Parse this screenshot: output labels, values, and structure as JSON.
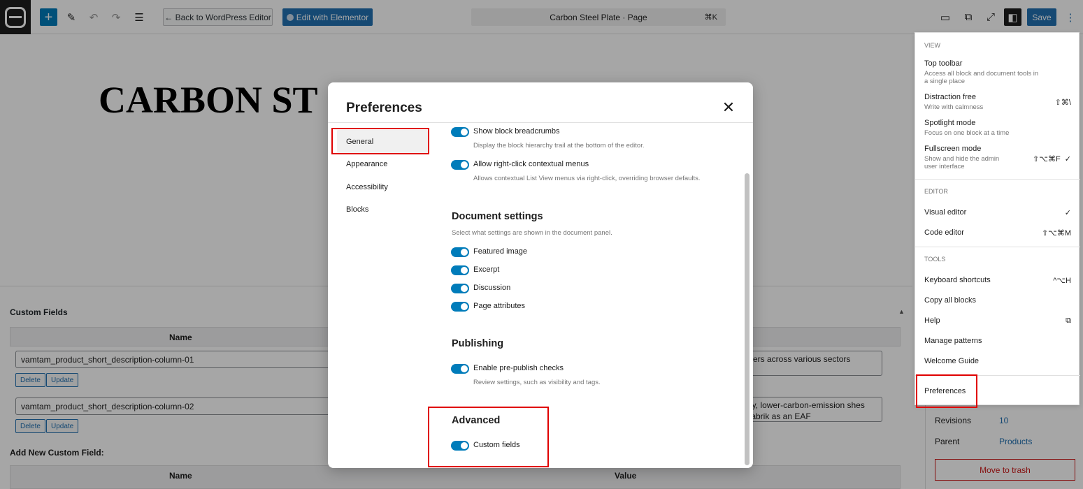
{
  "topbar": {
    "back_label": "← Back to WordPress Editor",
    "elementor_label": "Edit with Elementor",
    "doc_title": "Carbon Steel Plate · Page",
    "doc_shortcut": "⌘K",
    "save_label": "Save"
  },
  "canvas": {
    "title": "CARBON ST"
  },
  "custom_fields": {
    "title": "Custom Fields",
    "name_header": "Name",
    "rows": [
      {
        "name": "vamtam_product_short_description-column-01",
        "value": "mers across various sectors",
        "delete": "Delete",
        "update": "Update"
      },
      {
        "name": "vamtam_product_short_description-column-02",
        "value": "lity, lower-carbon-emission shes Fabrik as an EAF",
        "delete": "Delete",
        "update": "Update"
      }
    ],
    "add_new": "Add New Custom Field:",
    "add_name_header": "Name",
    "add_value_header": "Value"
  },
  "document_sidebar": {
    "revisions_label": "Revisions",
    "revisions_value": "10",
    "parent_label": "Parent",
    "parent_value": "Products",
    "trash_label": "Move to trash"
  },
  "options_menu": {
    "view_title": "VIEW",
    "top_toolbar": {
      "label": "Top toolbar",
      "desc": "Access all block and document tools in a single place"
    },
    "distraction_free": {
      "label": "Distraction free",
      "desc": "Write with calmness",
      "shortcut": "⇧⌘\\"
    },
    "spotlight": {
      "label": "Spotlight mode",
      "desc": "Focus on one block at a time"
    },
    "fullscreen": {
      "label": "Fullscreen mode",
      "desc": "Show and hide the admin user interface",
      "shortcut": "⇧⌥⌘F  ✓"
    },
    "editor_title": "EDITOR",
    "visual_editor": {
      "label": "Visual editor",
      "shortcut": "✓"
    },
    "code_editor": {
      "label": "Code editor",
      "shortcut": "⇧⌥⌘M"
    },
    "tools_title": "TOOLS",
    "keyboard_shortcuts": {
      "label": "Keyboard shortcuts",
      "shortcut": "^⌥H"
    },
    "copy_all_blocks": {
      "label": "Copy all blocks"
    },
    "help": {
      "label": "Help"
    },
    "manage_patterns": {
      "label": "Manage patterns"
    },
    "welcome_guide": {
      "label": "Welcome Guide"
    },
    "preferences": {
      "label": "Preferences"
    }
  },
  "preferences_modal": {
    "title": "Preferences",
    "nav": [
      "General",
      "Appearance",
      "Accessibility",
      "Blocks"
    ],
    "options": {
      "breadcrumbs": {
        "label": "Show block breadcrumbs",
        "desc": "Display the block hierarchy trail at the bottom of the editor.",
        "enabled": true
      },
      "right_click": {
        "label": "Allow right-click contextual menus",
        "desc": "Allows contextual List View menus via right-click, overriding browser defaults.",
        "enabled": true
      }
    },
    "document_settings": {
      "title": "Document settings",
      "desc": "Select what settings are shown in the document panel.",
      "items": [
        {
          "label": "Featured image",
          "enabled": true
        },
        {
          "label": "Excerpt",
          "enabled": true
        },
        {
          "label": "Discussion",
          "enabled": true
        },
        {
          "label": "Page attributes",
          "enabled": true
        }
      ]
    },
    "publishing": {
      "title": "Publishing",
      "prepublish": {
        "label": "Enable pre-publish checks",
        "desc": "Review settings, such as visibility and tags.",
        "enabled": true
      }
    },
    "advanced": {
      "title": "Advanced",
      "custom_fields": {
        "label": "Custom fields",
        "enabled": true
      }
    }
  },
  "colors": {
    "accent": "#007cba",
    "highlight": "#e00000"
  }
}
